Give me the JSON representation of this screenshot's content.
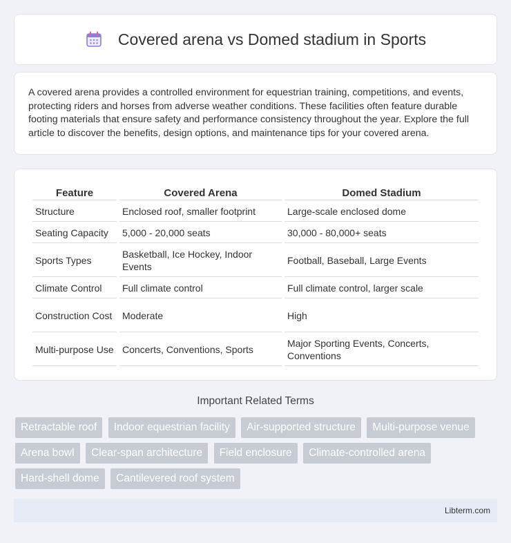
{
  "header": {
    "title": "Covered arena vs Domed stadium in Sports",
    "icon": "calendar-icon",
    "icon_color": "#8a7fdb"
  },
  "intro": {
    "text": "A covered arena provides a controlled environment for equestrian training, competitions, and events, protecting riders and horses from adverse weather conditions. These facilities often feature durable footing materials that ensure safety and performance consistency throughout the year. Explore the full article to discover the benefits, design options, and maintenance tips for your covered arena."
  },
  "table": {
    "headers": [
      "Feature",
      "Covered Arena",
      "Domed Stadium"
    ],
    "rows": [
      [
        "Structure",
        "Enclosed roof, smaller footprint",
        "Large-scale enclosed dome"
      ],
      [
        "Seating Capacity",
        "5,000 - 20,000 seats",
        "30,000 - 80,000+ seats"
      ],
      [
        "Sports Types",
        "Basketball, Ice Hockey, Indoor Events",
        "Football, Baseball, Large Events"
      ],
      [
        "Climate Control",
        "Full climate control",
        "Full climate control, larger scale"
      ],
      [
        "Construction Cost",
        "Moderate",
        "High"
      ],
      [
        "Multi-purpose Use",
        "Concerts, Conventions, Sports",
        "Major Sporting Events, Concerts, Conventions"
      ]
    ]
  },
  "terms": {
    "title": "Important Related Terms",
    "items": [
      "Retractable roof",
      "Indoor equestrian facility",
      "Air-supported structure",
      "Multi-purpose venue",
      "Arena bowl",
      "Clear-span architecture",
      "Field enclosure",
      "Climate-controlled arena",
      "Hard-shell dome",
      "Cantilevered roof system"
    ]
  },
  "footer": {
    "text": "Libterm.com"
  }
}
